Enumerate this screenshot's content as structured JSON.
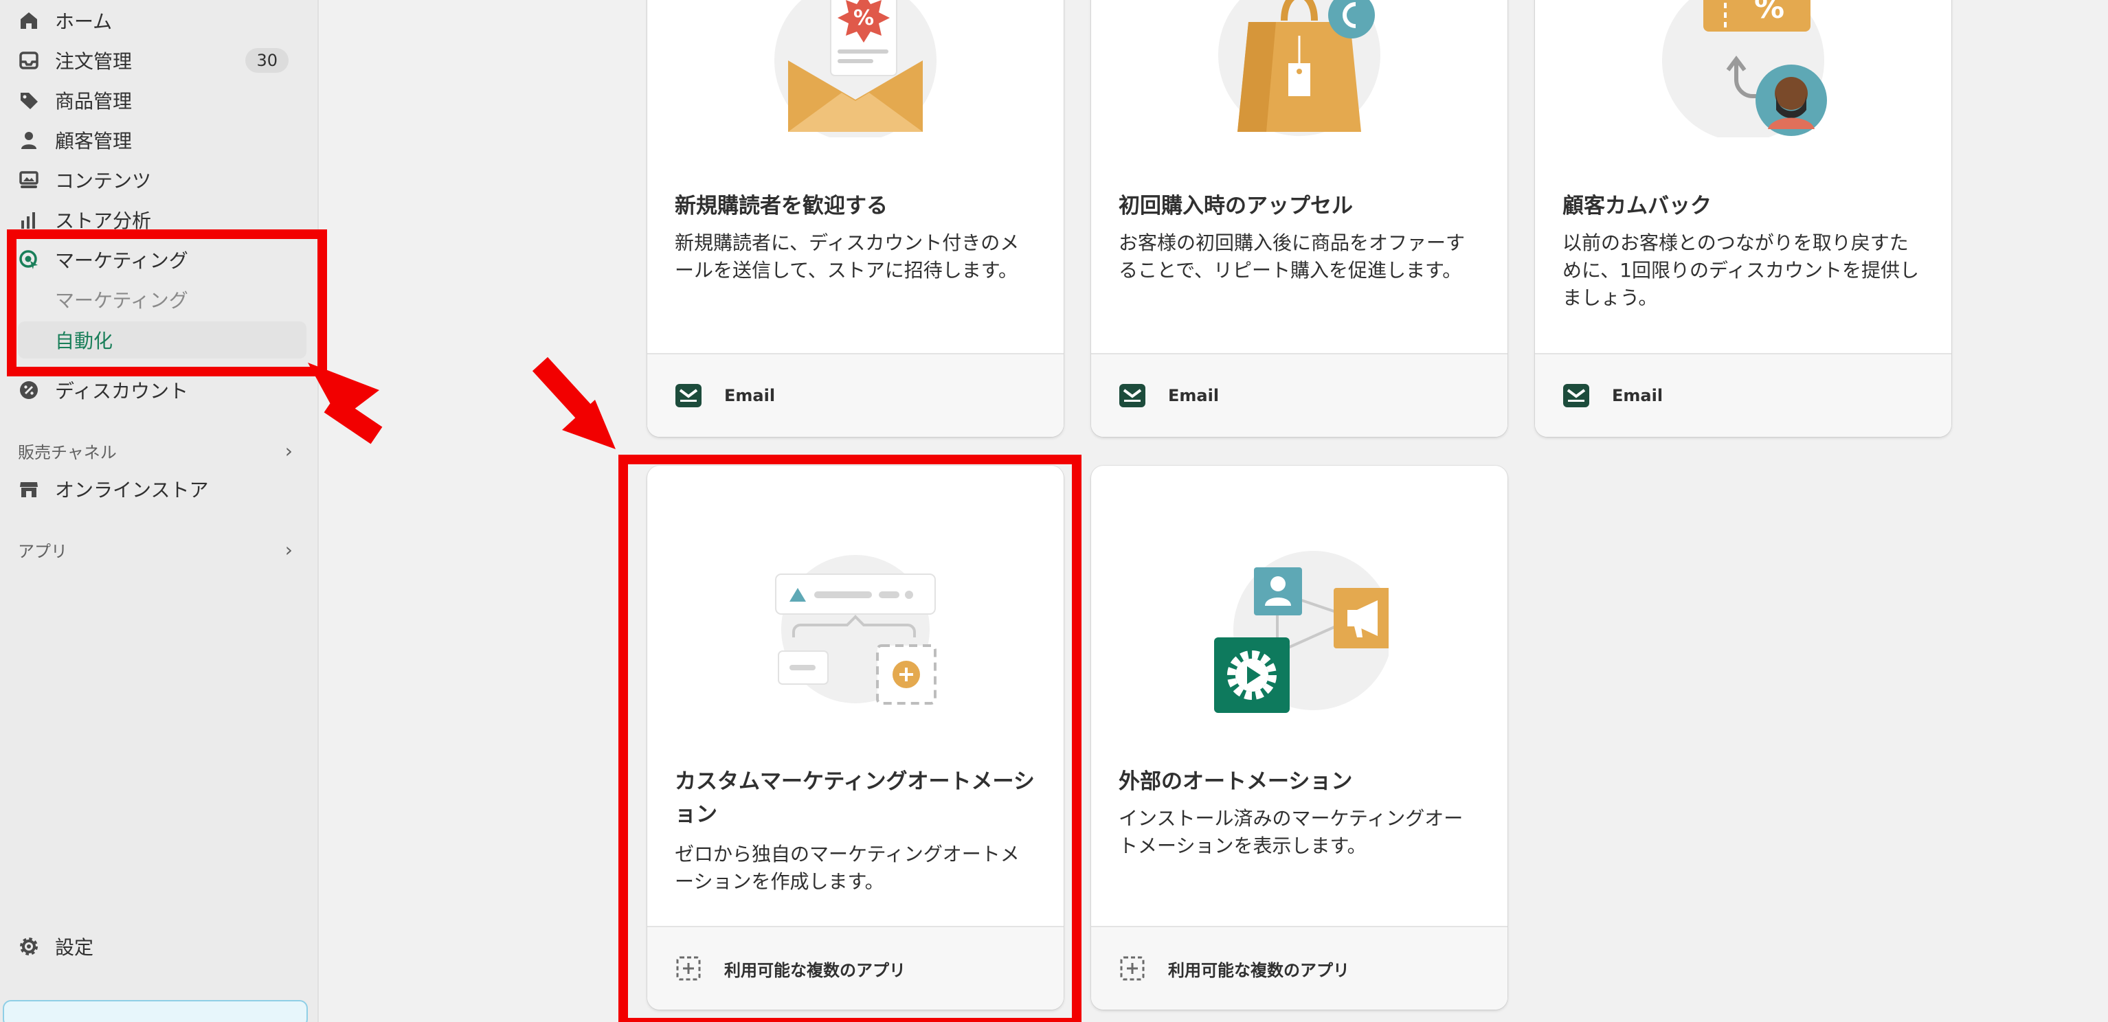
{
  "sidebar": {
    "items": [
      {
        "label": "ホーム"
      },
      {
        "label": "注文管理",
        "badge": "30"
      },
      {
        "label": "商品管理"
      },
      {
        "label": "顧客管理"
      },
      {
        "label": "コンテンツ"
      },
      {
        "label": "ストア分析"
      },
      {
        "label": "マーケティング"
      },
      {
        "label": "ディスカウント"
      }
    ],
    "subitems": [
      {
        "label": "マーケティング"
      },
      {
        "label": "自動化"
      }
    ],
    "sections": [
      {
        "label": "販売チャネル"
      },
      {
        "label": "アプリ"
      }
    ],
    "online_store": "オンラインストア",
    "settings": "設定"
  },
  "cards": [
    {
      "title": "新規購読者を歓迎する",
      "desc": "新規購読者に、ディスカウント付きのメールを送信して、ストアに招待します。",
      "foot": "Email",
      "icon": "envelope-discount"
    },
    {
      "title": "初回購入時のアップセル",
      "desc": "お客様の初回購入後に商品をオファーすることで、リピート購入を促進します。",
      "foot": "Email",
      "icon": "shopping-bag"
    },
    {
      "title": "顧客カムバック",
      "desc": "以前のお客様とのつながりを取り戻すために、1回限りのディスカウントを提供しましょう。",
      "foot": "Email",
      "icon": "coupon-return"
    },
    {
      "title": "カスタムマーケティングオートメーション",
      "desc": "ゼロから独自のマーケティングオートメーションを作成します。",
      "foot": "利用可能な複数のアプリ",
      "icon": "custom-workflow"
    },
    {
      "title": "外部のオートメーション",
      "desc": "インストール済みのマーケティングオートメーションを表示します。",
      "foot": "利用可能な複数のアプリ",
      "icon": "external-automation"
    }
  ],
  "colors": {
    "accent_green": "#1a7f5a",
    "annotation_red": "#f20000",
    "illus_orange": "#e4a94f",
    "illus_teal": "#5ea8b5",
    "illus_dark_green": "#0e7a5d"
  }
}
